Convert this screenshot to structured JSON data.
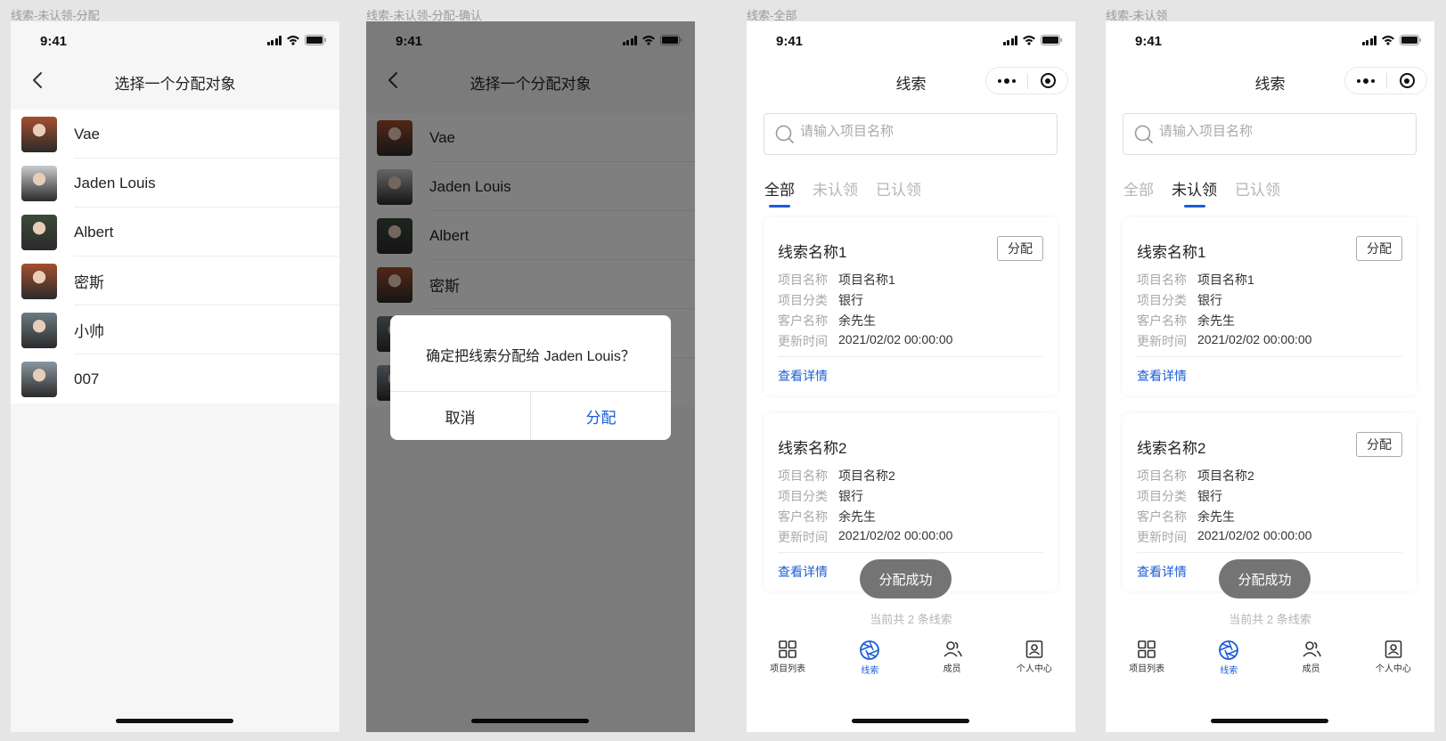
{
  "frames": {
    "f1": {
      "label": "线索-未认领-分配"
    },
    "f2": {
      "label": "线索-未认领-分配-确认"
    },
    "f3": {
      "label": "线索-全部"
    },
    "f4": {
      "label": "线索-未认领"
    }
  },
  "status": {
    "time": "9:41"
  },
  "assign_page": {
    "title": "选择一个分配对象",
    "people": [
      {
        "name": "Vae",
        "avatar_color": "#a24f2c"
      },
      {
        "name": "Jaden Louis",
        "avatar_color": "#c9cbcf"
      },
      {
        "name": "Albert",
        "avatar_color": "#3b4a3a"
      },
      {
        "name": "密斯",
        "avatar_color": "#a24f2c"
      },
      {
        "name": "小帅",
        "avatar_color": "#6c7a82"
      },
      {
        "name": "007",
        "avatar_color": "#8a96a0"
      }
    ]
  },
  "confirm_dialog": {
    "message": "确定把线索分配给 Jaden Louis？",
    "cancel": "取消",
    "confirm": "分配"
  },
  "leads_page": {
    "title": "线索",
    "search_placeholder": "请输入项目名称",
    "tabs": [
      "全部",
      "未认领",
      "已认领"
    ],
    "field_labels": {
      "project": "项目名称",
      "category": "项目分类",
      "customer": "客户名称",
      "updated": "更新时间"
    },
    "cards": [
      {
        "title": "线索名称1",
        "assign": "分配",
        "project": "项目名称1",
        "category": "银行",
        "customer": "余先生",
        "updated": "2021/02/02 00:00:00",
        "detail": "查看详情"
      },
      {
        "title": "线索名称2",
        "assign": "分配",
        "project": "项目名称2",
        "category": "银行",
        "customer": "余先生",
        "updated": "2021/02/02 00:00:00",
        "detail": "查看详情"
      }
    ],
    "toast": "分配成功",
    "count": "当前共 2 条线索",
    "tabbar": [
      "项目列表",
      "线索",
      "成员",
      "个人中心"
    ],
    "accent": "#1a5dd9"
  }
}
